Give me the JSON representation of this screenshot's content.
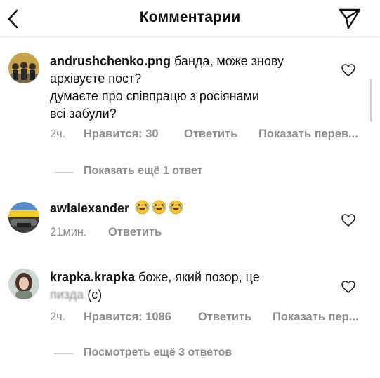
{
  "header": {
    "title": "Комментарии",
    "back_icon": "chevron-left-icon",
    "send_icon": "paper-plane-icon"
  },
  "comments": [
    {
      "username": "andrushchenko.png",
      "text_line1": "банда, може знову",
      "text_line2": "архівуєте пост?",
      "text_line3": "думаєте про співпрацю з росіянами",
      "text_line4": "всі забули?",
      "time": "2ч.",
      "likes": "Нравится: 30",
      "reply": "Ответить",
      "translate": "Показать перев..."
    },
    {
      "username": "awlalexander",
      "emoji": "😂😂😂",
      "time": "21мин.",
      "reply": "Ответить"
    },
    {
      "username": "krapka.krapka",
      "text_line1": "боже, який позор, це",
      "text_blurred": "пизда",
      "text_suffix": "(с)",
      "time": "2ч.",
      "likes": "Нравится: 1086",
      "reply": "Ответить",
      "translate": "Показать пер..."
    }
  ],
  "replies": [
    {
      "label": "Показать ещё 1 ответ"
    },
    {
      "label": "Посмотреть ещё 3 ответов"
    }
  ],
  "colors": {
    "text": "#111111",
    "muted": "#8e8e8e",
    "divider": "#e6e6e6"
  }
}
